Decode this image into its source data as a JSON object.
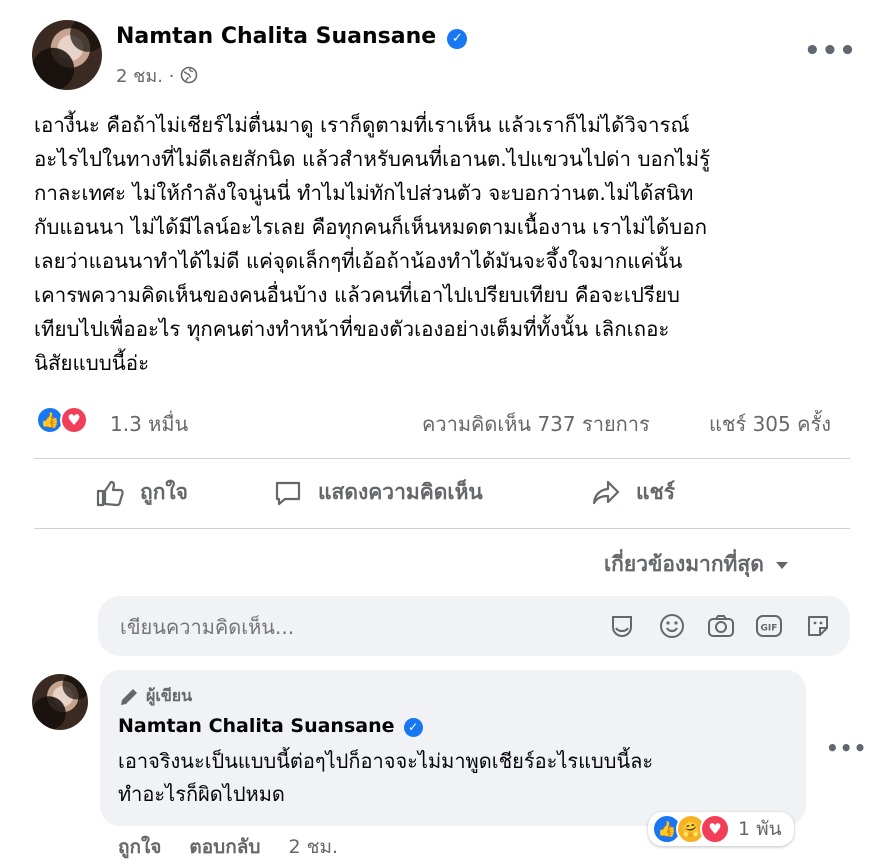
{
  "post": {
    "author": "Namtan Chalita Suansane",
    "time": "2 ชม.",
    "separator": "·",
    "text": "เอางี้นะ คือถ้าไม่เชียร์ไม่ตื่นมาดู เราก็ดูตามที่เราเห็น แล้วเราก็ไม่ได้วิจารณ์\nอะไรไปในทางที่ไม่ดีเลยสักนิด แล้วสำหรับคนที่เอานต.ไปแขวนไปด่า บอกไม่รู้\nกาละเทศะ ไม่ให้กำลังใจนู่นนี่ ทำไมไม่ทักไปส่วนตัว จะบอกว่านต.ไม่ได้สนิท\nกับแอนนา ไม่ได้มีไลน์อะไรเลย คือทุกคนก็เห็นหมดตามเนื้องาน เราไม่ได้บอก\nเลยว่าแอนนาทำได้ไม่ดี แค่จุดเล็กๆที่เอ้อถ้าน้องทำได้มันจะจึ้งใจมากแค่นั้น\nเคารพความคิดเห็นของคนอื่นบ้าง แล้วคนที่เอาไปเปรียบเทียบ คือจะเปรียบ\nเทียบไปเพื่ออะไร ทุกคนต่างทำหน้าที่ของตัวเองอย่างเต็มที่ทั้งนั้น เลิกเถอะ\nนิสัยแบบนี้อ่ะ",
    "reaction_count": "1.3 หมื่น",
    "comment_count": "ความคิดเห็น 737 รายการ",
    "share_count": "แชร์ 305 ครั้ง"
  },
  "actions": {
    "like": "ถูกใจ",
    "comment": "แสดงความคิดเห็น",
    "share": "แชร์"
  },
  "sort": {
    "label": "เกี่ยวข้องมากที่สุด"
  },
  "composer": {
    "placeholder": "เขียนความคิดเห็น..."
  },
  "comment": {
    "badge": "ผู้เขียน",
    "author": "Namtan Chalita Suansane",
    "text": "เอาจริงนะเป็นแบบนี้ต่อๆไปก็อาจจะไม่มาพูดเชียร์อะไรแบบนี้ละ\nทำอะไรก็ผิดไปหมด",
    "like": "ถูกใจ",
    "reply": "ตอบกลับ",
    "time": "2 ชม.",
    "reaction_count": "1 พัน"
  },
  "icons": {
    "like": "like-icon",
    "love": "love-icon",
    "care": "care-icon",
    "globe": "globe-icon",
    "more": "more-options-icon",
    "comment": "comment-icon",
    "share": "share-icon",
    "chevron": "chevron-down-icon",
    "sticker": "sticker-icon",
    "emoji": "emoji-icon",
    "camera": "camera-icon",
    "gif": "gif-icon",
    "avatar_sticker": "avatar-sticker-icon",
    "pencil": "pencil-icon",
    "verified": "verified-badge-icon"
  },
  "colors": {
    "brand_blue": "#1877f2",
    "love_red": "#f33e58",
    "muted_text": "#65676b",
    "bubble_bg": "#f0f2f5"
  }
}
